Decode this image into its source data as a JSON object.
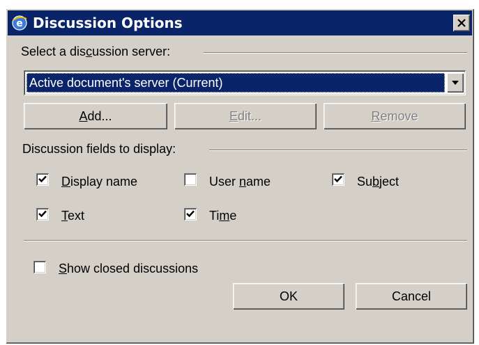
{
  "window": {
    "title": "Discussion Options",
    "close_icon": "close-icon",
    "app_icon": "internet-explorer-icon"
  },
  "server": {
    "label_pre": "Select a dis",
    "label_key": "c",
    "label_post": "ussion server:",
    "selected": "Active document's server (Current)"
  },
  "buttons": {
    "add": {
      "key": "A",
      "rest": "dd..."
    },
    "edit": {
      "key": "E",
      "rest": "dit..."
    },
    "remove": {
      "key": "R",
      "rest": "emove"
    }
  },
  "fields": {
    "label": "Discussion fields to display:",
    "display_name": {
      "key": "D",
      "rest": "isplay name",
      "checked": true
    },
    "user_name": {
      "pre": "User ",
      "key": "n",
      "post": "ame",
      "checked": false
    },
    "subject": {
      "pre": "Su",
      "key": "b",
      "post": "ject",
      "checked": true
    },
    "text": {
      "key": "T",
      "rest": "ext",
      "checked": true
    },
    "time": {
      "pre": "Ti",
      "key": "m",
      "post": "e",
      "checked": true
    }
  },
  "show_closed": {
    "key": "S",
    "rest": "how closed discussions",
    "checked": false
  },
  "ok_label": "OK",
  "cancel_label": "Cancel",
  "colors": {
    "titlebar": "#0a246a",
    "face": "#d4d0c8",
    "selection": "#0a246a"
  }
}
